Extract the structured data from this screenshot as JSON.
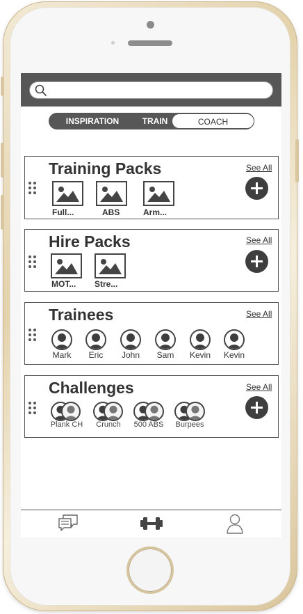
{
  "search": {
    "placeholder": "",
    "value": ""
  },
  "segment": {
    "tabs": [
      {
        "label": "INSPIRATION",
        "active": false
      },
      {
        "label": "TRAIN",
        "active": false
      },
      {
        "label": "COACH",
        "active": true
      }
    ]
  },
  "sections": {
    "training_packs": {
      "title": "Training Packs",
      "see_all": "See All",
      "items": [
        "Full...",
        "ABS",
        "Arm..."
      ]
    },
    "hire_packs": {
      "title": "Hire Packs",
      "see_all": "See All",
      "items": [
        "MOT...",
        "Stre..."
      ]
    },
    "trainees": {
      "title": "Trainees",
      "see_all": "See All",
      "items": [
        "Mark",
        "Eric",
        "John",
        "Sam",
        "Kevin",
        "Kevin"
      ]
    },
    "challenges": {
      "title": "Challenges",
      "see_all": "See All",
      "items": [
        "Plank CH",
        "Crunch",
        "500 ABS",
        "Burpees"
      ]
    }
  },
  "tabbar": {
    "items": [
      {
        "icon": "chat-icon"
      },
      {
        "icon": "dumbbell-icon"
      },
      {
        "icon": "profile-icon"
      }
    ]
  },
  "colors": {
    "dark": "#575757",
    "accent": "#3e3e3e",
    "frame": "#e3d2ab"
  }
}
